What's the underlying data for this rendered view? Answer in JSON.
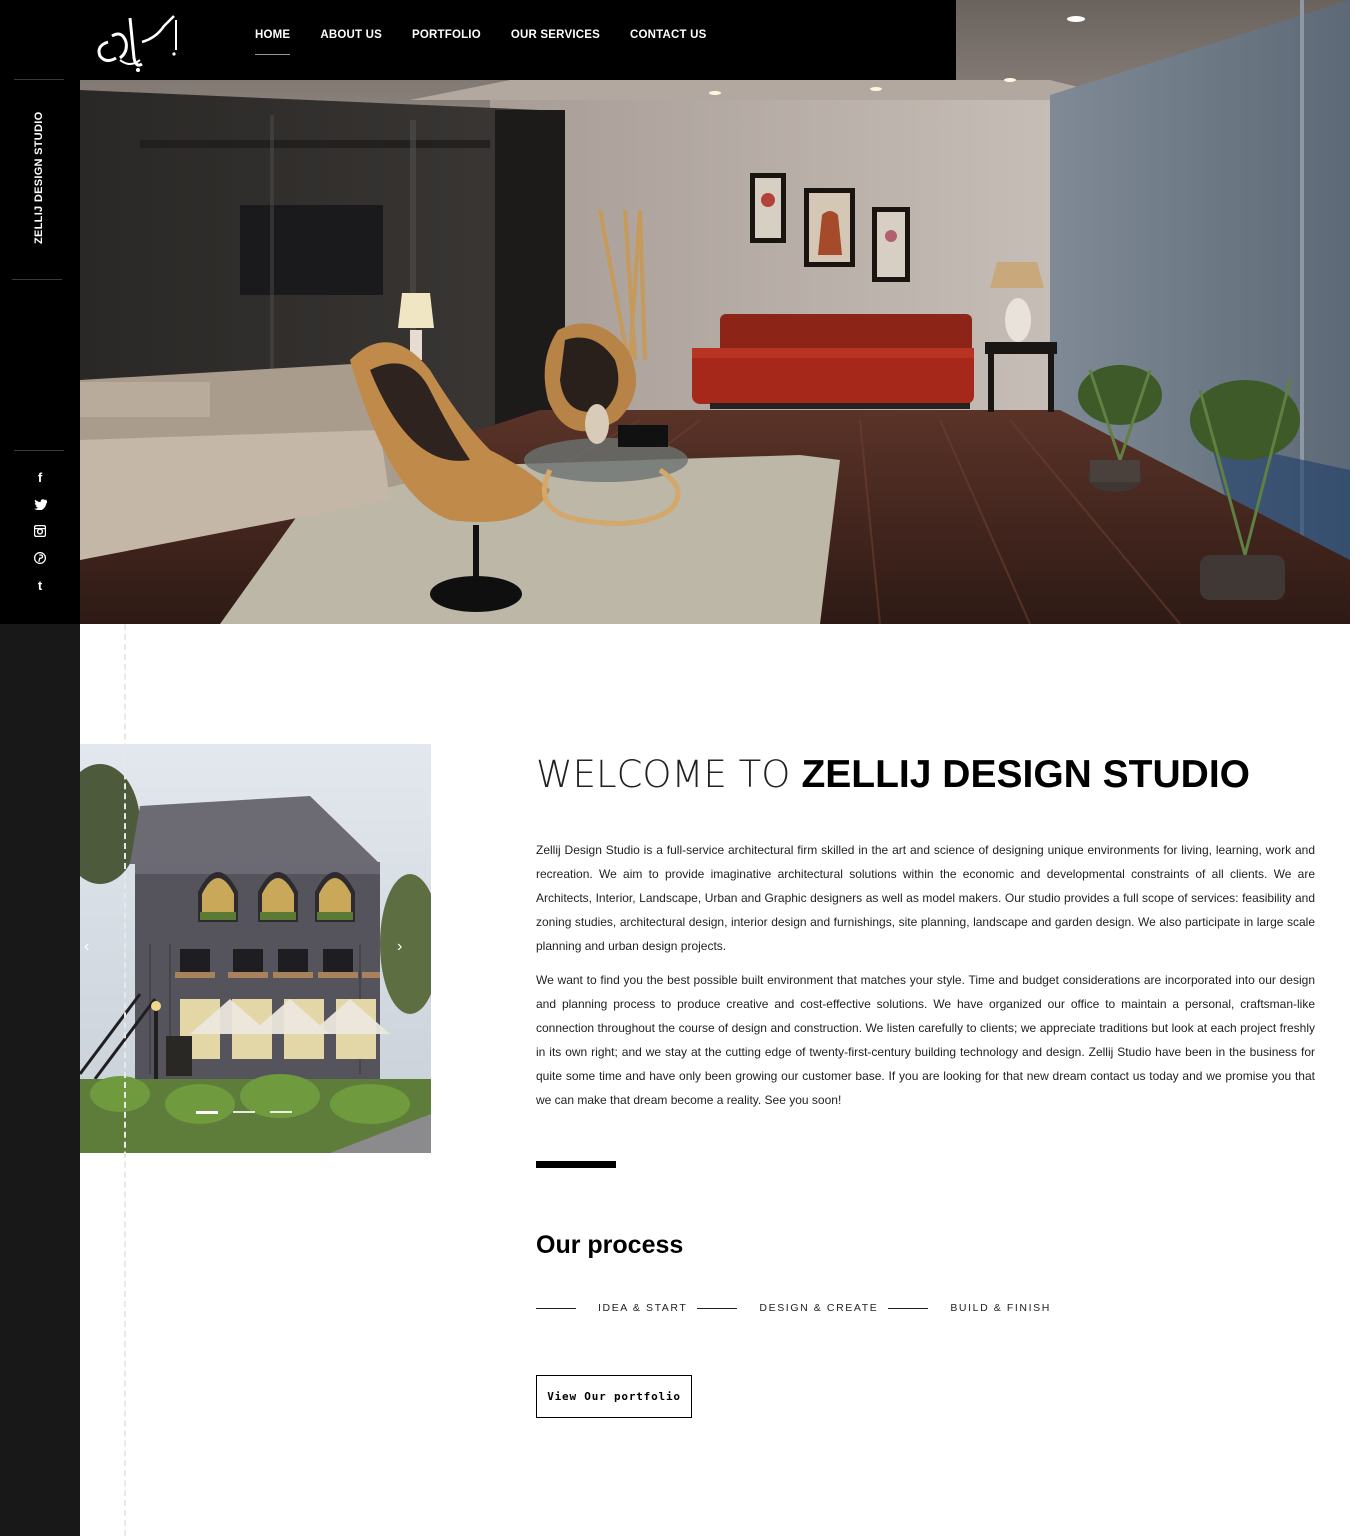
{
  "brand": {
    "vertical_name": "ZELLIJ DESIGN STUDIO"
  },
  "nav": {
    "items": [
      "HOME",
      "ABOUT US",
      "PORTFOLIO",
      "OUR SERVICES",
      "CONTACT US"
    ],
    "active_index": 0
  },
  "social": {
    "icons": [
      "facebook-icon",
      "twitter-icon",
      "instagram-icon",
      "pinterest-icon",
      "tumblr-icon"
    ],
    "glyphs": [
      "f",
      "t",
      "◙",
      "℗",
      "t"
    ]
  },
  "slider": {
    "prev": "‹",
    "next": "›",
    "dot_count": 3,
    "active_dot": 0
  },
  "welcome": {
    "light": "WELCOME TO",
    "bold": "ZELLIJ DESIGN STUDIO"
  },
  "intro": {
    "paragraph_1": "Zellij Design Studio is a full-service architectural firm skilled in the art and science of designing unique environments for living, learning, work and recreation. We aim to provide imaginative architectural solutions within the economic and developmental constraints of all clients. We are Architects, Interior, Landscape, Urban and Graphic designers as well as model makers. Our studio provides a full scope of services: feasibility and zoning studies, architectural design, interior design and furnishings, site planning, landscape and garden design. We also participate in large scale planning and urban design projects.",
    "paragraph_2": "We want to find you the best possible built environment that matches your style. Time and budget considerations are incorporated into our design and planning process to produce creative and cost-effective solutions. We have organized our office to maintain a personal, craftsman-like connection throughout the course of design and construction. We listen carefully to clients; we appreciate traditions but look at each project freshly in its own right; and we stay at the cutting edge of twenty-first-century building technology and design. Zellij Studio have been in the business for quite some time and have only been growing our customer base. If you are looking for that new dream contact us today and we promise you that we can make that dream become a reality. See you soon!"
  },
  "process": {
    "title": "Our process",
    "steps": [
      "IDEA & START",
      "DESIGN & CREATE",
      "BUILD & FINISH"
    ]
  },
  "cta": {
    "portfolio_label": "View Our portfolio"
  },
  "colors": {
    "sidebar": "#000000",
    "sidebar_lower": "#181818",
    "accent": "#000000",
    "sofa": "#a5281a",
    "wood": "#c08a4a"
  }
}
